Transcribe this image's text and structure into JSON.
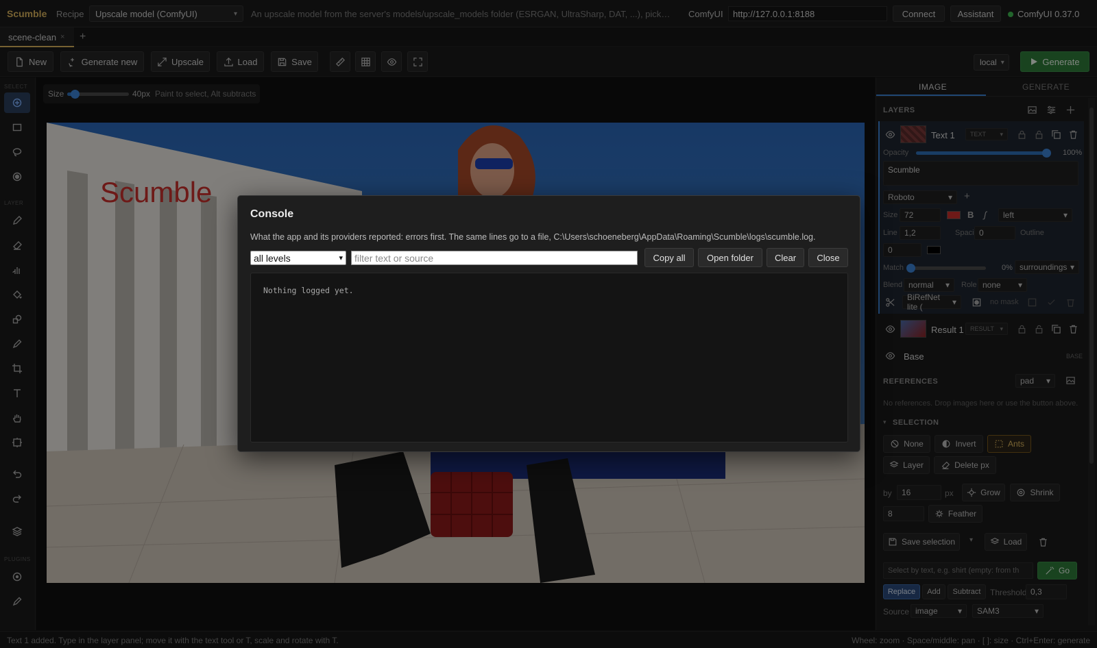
{
  "topbar": {
    "app_name": "Scumble",
    "recipe_label": "Recipe",
    "recipe_value": "Upscale model (ComfyUI)",
    "recipe_description": "An upscale model from the server's models/upscale_models folder (ESRGAN, UltraSharp, DAT, ...), picked ...",
    "comfy_label": "ComfyUI",
    "comfy_url": "http://127.0.0.1:8188",
    "connect_label": "Connect",
    "assistant_label": "Assistant",
    "status_text": "ComfyUI 0.37.0",
    "status_color": "#3fb950"
  },
  "tabs": {
    "active_label": "scene-clean",
    "close_glyph": "×",
    "add_glyph": "+"
  },
  "toolbar": {
    "new_label": "New",
    "generate_new_label": "Generate new",
    "upscale_label": "Upscale",
    "load_label": "Load",
    "save_label": "Save",
    "backend_value": "local",
    "generate_label": "Generate",
    "generate_color": "#2f7a3a"
  },
  "rail": {
    "select_label": "SELECT",
    "layer_label": "LAYER",
    "plugins_label": "PLUGINS"
  },
  "brush": {
    "size_label": "Size",
    "size_value": "40px",
    "size_fraction": 0.12,
    "hint": "Paint to select, Alt subtracts"
  },
  "canvas": {
    "overlay_text": "Scumble",
    "overlay_text_color": "#c9302c"
  },
  "panel": {
    "tab_image": "IMAGE",
    "tab_generate": "GENERATE",
    "layers_title": "LAYERS",
    "layer_text": {
      "name": "Text 1",
      "type": "TEXT",
      "opacity_label": "Opacity",
      "opacity_value": "100%",
      "opacity_fraction": 1.0,
      "content": "Scumble",
      "font": "Roboto",
      "size_label": "Size",
      "size_value": "72",
      "color": "#c9302c",
      "align_value": "left",
      "line_label": "Line",
      "line_value": "1,2",
      "spacing_label": "Spacing",
      "spacing_value": "0",
      "outline_label": "Outline",
      "outline_value": "0",
      "match_label": "Match",
      "match_value": "0%",
      "match_fraction": 0.0,
      "match_mode": "surroundings",
      "blend_label": "Blend",
      "blend_value": "normal",
      "role_label": "Role",
      "role_value": "none",
      "mask_model": "BiRefNet lite (",
      "mask_status": "no mask"
    },
    "layer_result": {
      "name": "Result 1",
      "type": "RESULT"
    },
    "layer_base": {
      "name": "Base",
      "tag": "BASE"
    },
    "references_title": "REFERENCES",
    "references_mode": "pad",
    "references_hint": "No references. Drop images here or use the button above.",
    "selection_title": "SELECTION",
    "sel_none": "None",
    "sel_invert": "Invert",
    "sel_ants": "Ants",
    "sel_layer": "Layer",
    "sel_delete": "Delete px",
    "by_label": "by",
    "by_value": "16",
    "px_label": "px",
    "grow_label": "Grow",
    "shrink_label": "Shrink",
    "feather_value": "8",
    "feather_label": "Feather",
    "save_selection_label": "Save selection",
    "load_label": "Load",
    "text_select_placeholder": "Select by text, e.g. shirt (empty: from th",
    "go_label": "Go",
    "mode_replace": "Replace",
    "mode_add": "Add",
    "mode_subtract": "Subtract",
    "threshold_label": "Threshold",
    "threshold_value": "0,3",
    "source_label": "Source",
    "source_value": "image",
    "model_value": "SAM3"
  },
  "statusbar": {
    "left": "Text 1 added. Type in the layer panel; move it with the text tool or T, scale and rotate with T.",
    "right": "Wheel: zoom · Space/middle: pan · [ ]: size · Ctrl+Enter: generate"
  },
  "console": {
    "title": "Console",
    "description": "What the app and its providers reported: errors first. The same lines go to a file, C:\\Users\\schoeneberg\\AppData\\Roaming\\Scumble\\logs\\scumble.log.",
    "level_value": "all levels",
    "filter_placeholder": "filter text or source",
    "copy_all_label": "Copy all",
    "open_folder_label": "Open folder",
    "clear_label": "Clear",
    "close_label": "Close",
    "empty_message": "Nothing logged yet."
  }
}
